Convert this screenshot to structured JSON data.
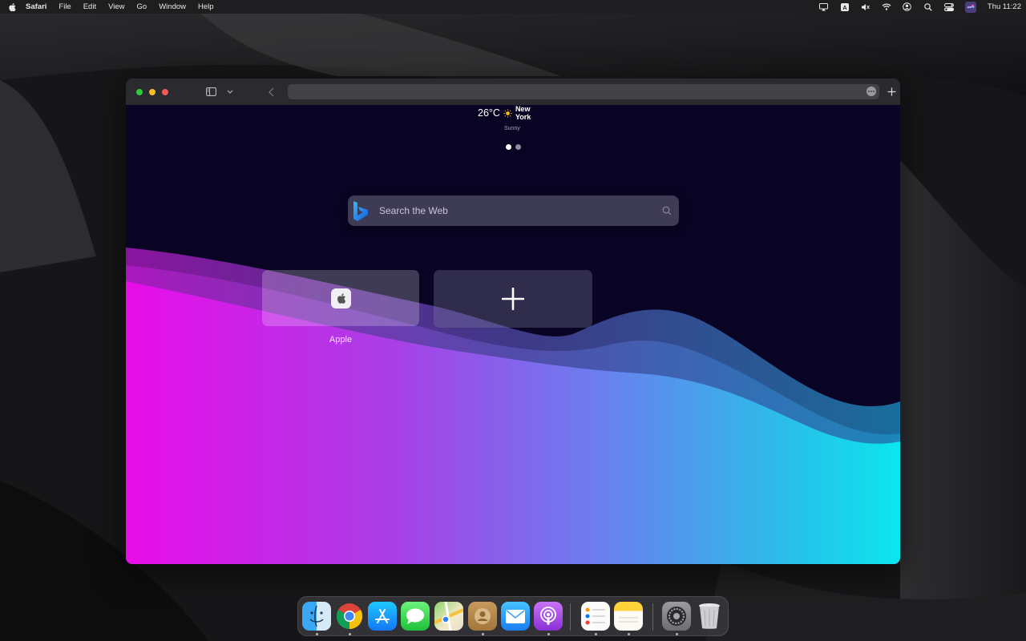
{
  "menubar": {
    "app_name": "Safari",
    "menus": [
      "File",
      "Edit",
      "View",
      "Go",
      "Window",
      "Help"
    ],
    "clock": "Thu 11:22",
    "status_icons": [
      "airplay-icon",
      "keyboard-input-icon",
      "mute-icon",
      "wifi-icon",
      "user-icon",
      "search-icon",
      "control-center-icon",
      "siri-icon"
    ]
  },
  "browser": {
    "address_value": "",
    "traffic_colors": [
      "#2fc940",
      "#f5b92c",
      "#f25a56"
    ]
  },
  "start_page": {
    "weather": {
      "temperature": "26°C",
      "city": "New York",
      "condition": "Sunny"
    },
    "search": {
      "placeholder": "Search the Web"
    },
    "favorites": [
      {
        "label": "Apple",
        "icon": "apple-icon"
      }
    ],
    "add_tile_icon": "plus-icon",
    "page_indicator": {
      "count": 2,
      "active": 0
    }
  },
  "dock": {
    "apps": [
      {
        "name": "Finder",
        "icon": "finder-icon",
        "running": true
      },
      {
        "name": "Chrome",
        "icon": "chrome-icon",
        "running": true
      },
      {
        "name": "App Store",
        "icon": "app-store-icon",
        "running": false
      },
      {
        "name": "Messages",
        "icon": "messages-icon",
        "running": false
      },
      {
        "name": "Maps",
        "icon": "maps-icon",
        "running": false
      },
      {
        "name": "Contacts",
        "icon": "contacts-icon",
        "running": true
      },
      {
        "name": "Mail",
        "icon": "mail-icon",
        "running": false
      },
      {
        "name": "Podcasts",
        "icon": "podcasts-icon",
        "running": true
      },
      {
        "name": "Reminders",
        "icon": "reminders-icon",
        "running": true
      },
      {
        "name": "Notes",
        "icon": "notes-icon",
        "running": true
      },
      {
        "name": "System Settings",
        "icon": "system-settings-icon",
        "running": true
      },
      {
        "name": "Trash",
        "icon": "trash-icon",
        "running": false
      }
    ]
  }
}
